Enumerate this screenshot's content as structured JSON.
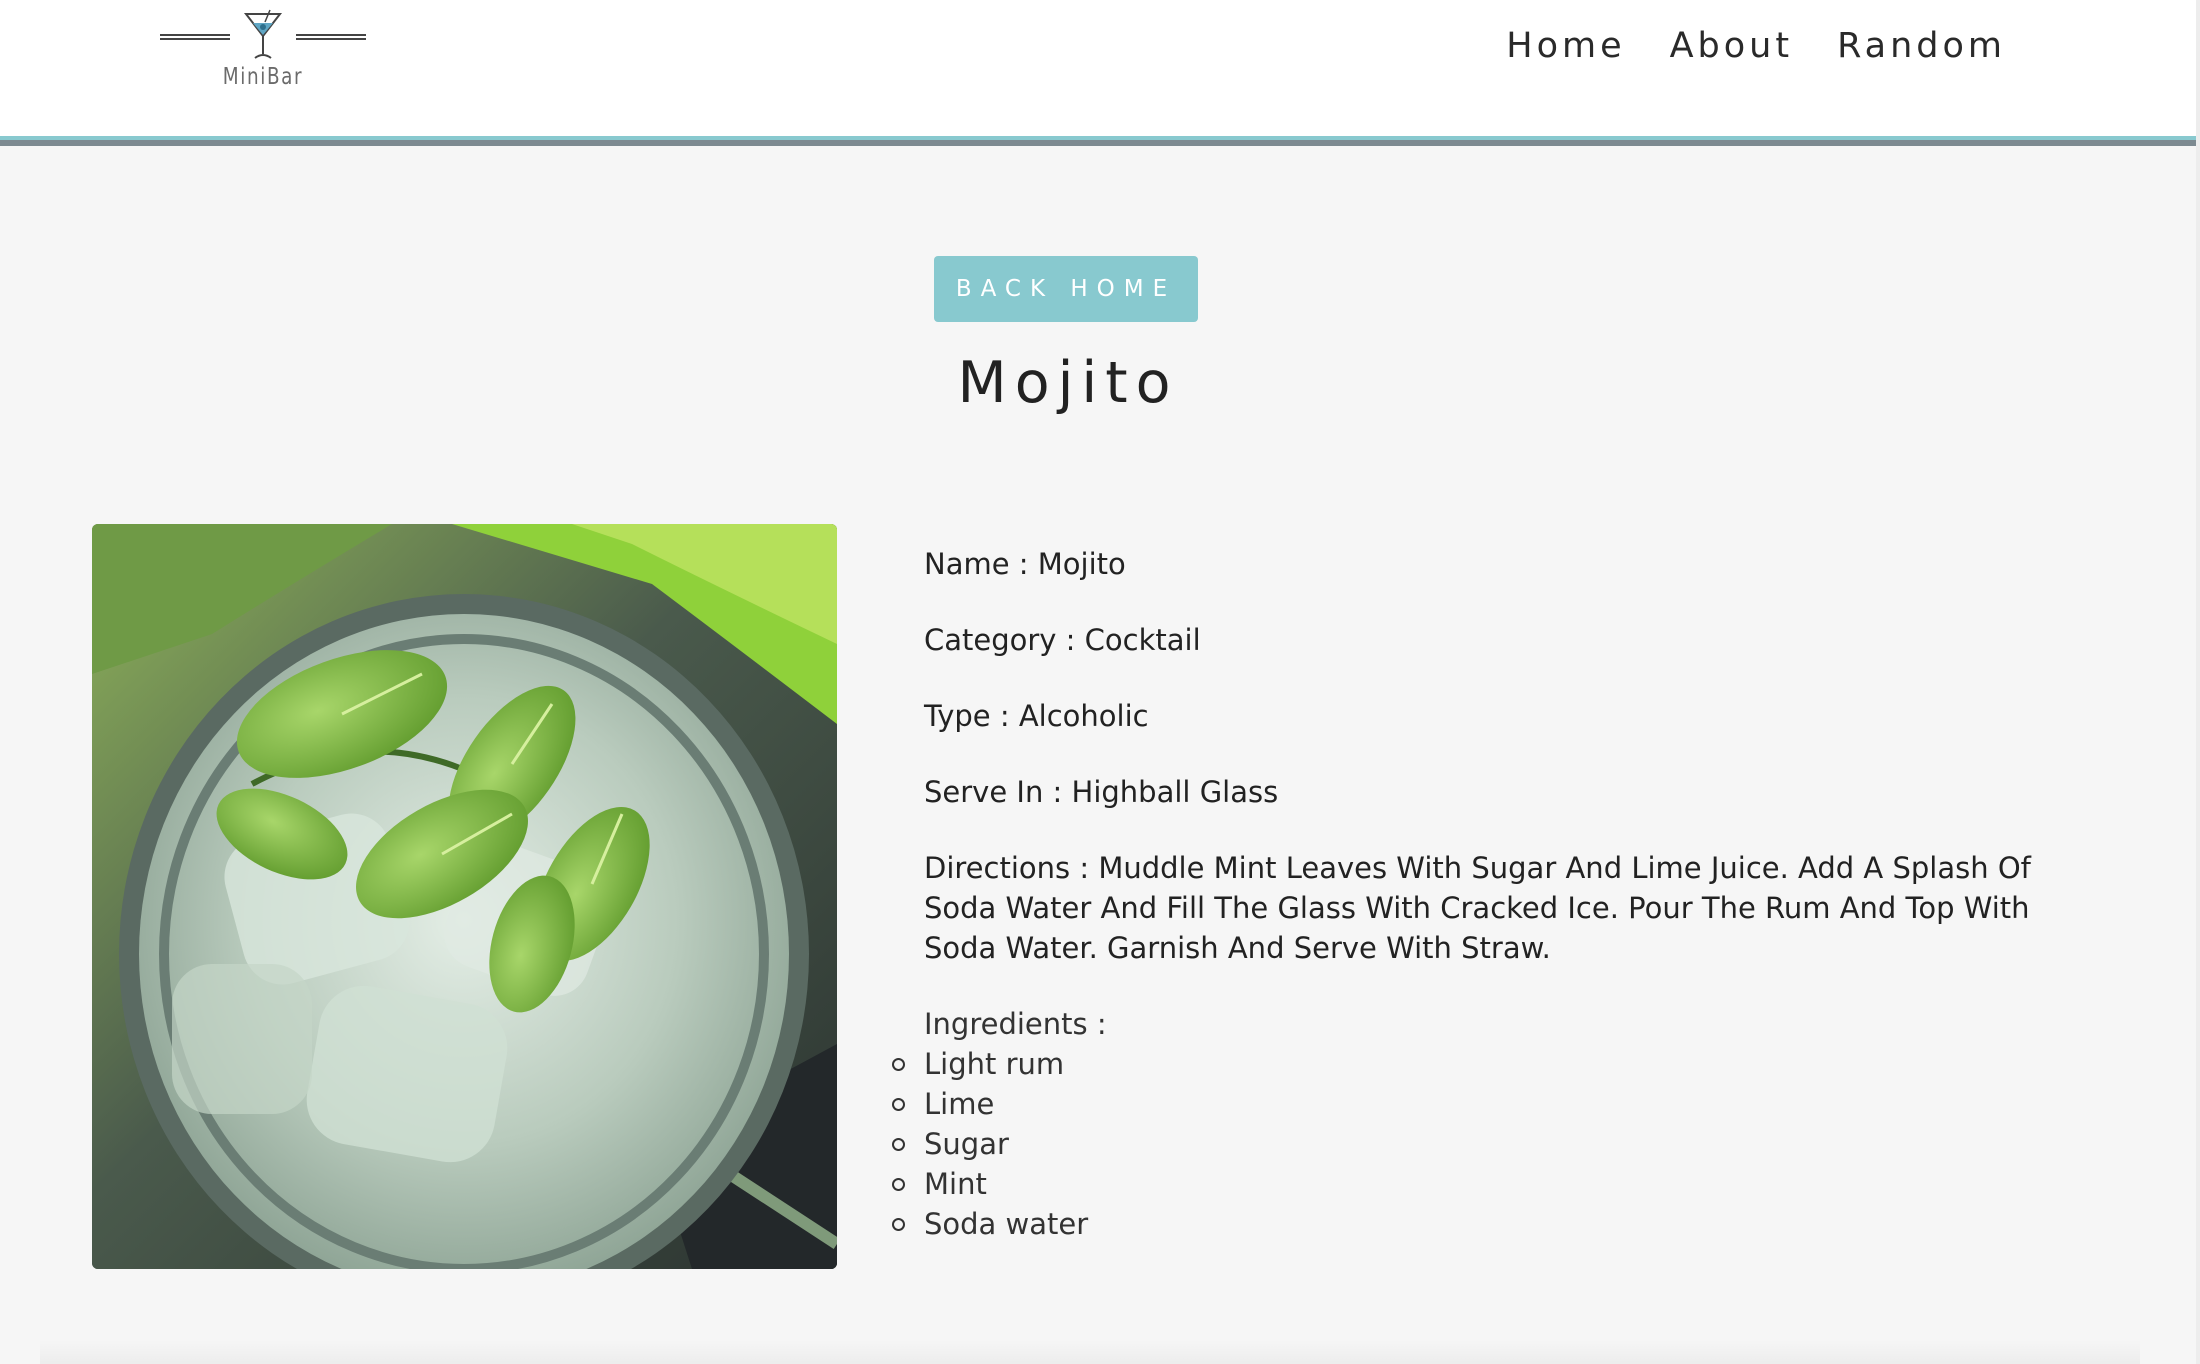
{
  "header": {
    "brand": "MiniBar",
    "nav": [
      {
        "label": "Home"
      },
      {
        "label": "About"
      },
      {
        "label": "Random"
      }
    ]
  },
  "hero": {
    "back_button_label": "BACK HOME",
    "title": "Mojito"
  },
  "drink": {
    "name_line": "Name : Mojito",
    "category_line": "Category : Cocktail",
    "type_line": "Type : Alcoholic",
    "serve_line": "Serve In : Highball Glass",
    "directions_line": "Directions : Muddle Mint Leaves With Sugar And Lime Juice. Add A Splash Of Soda Water And Fill The Glass With Cracked Ice. Pour The Rum And Top With Soda Water. Garnish And Serve With Straw.",
    "ingredients_label": "Ingredients :",
    "ingredients": [
      "Light rum",
      "Lime",
      "Sugar",
      "Mint",
      "Soda water"
    ]
  },
  "colors": {
    "accent": "#88c9cf",
    "header_border": "#7d8a91",
    "page_background": "#f6f6f6"
  },
  "icons": {
    "logo": "martini-glass-icon"
  }
}
